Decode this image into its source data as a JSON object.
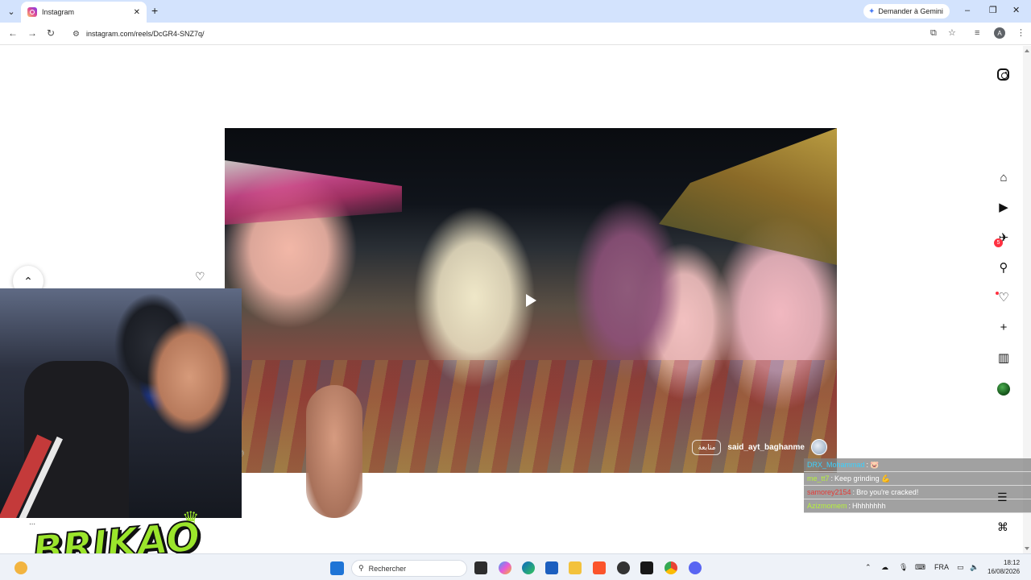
{
  "browser": {
    "tab_title": "Instagram",
    "url": "instagram.com/reels/DcGR4-SNZ7q/",
    "gemini_label": "Demander à Gemini",
    "profile_initial": "A"
  },
  "reel": {
    "username": "said_ayt_baghanme",
    "follow_label": "متابعة",
    "state": "paused"
  },
  "sidebar": {
    "messages_badge": "5"
  },
  "stream_overlay": {
    "logo_text": "BRIKAO",
    "chat": [
      {
        "user": "DRX_Mohammad",
        "user_color": "#3ad1ff",
        "message": "🐷"
      },
      {
        "user": "me_tt7",
        "user_color": "#b6f23a",
        "message": "Keep grinding 💪"
      },
      {
        "user": "samorey2154",
        "user_color": "#e53935",
        "message": "Bro you're cracked!"
      },
      {
        "user": "Azizmomem",
        "user_color": "#b6f23a",
        "message": "Hhhhhhhh"
      }
    ]
  },
  "taskbar": {
    "search_placeholder": "Rechercher",
    "language": "FRA",
    "time": "18:12",
    "date": "16/08/2026"
  }
}
